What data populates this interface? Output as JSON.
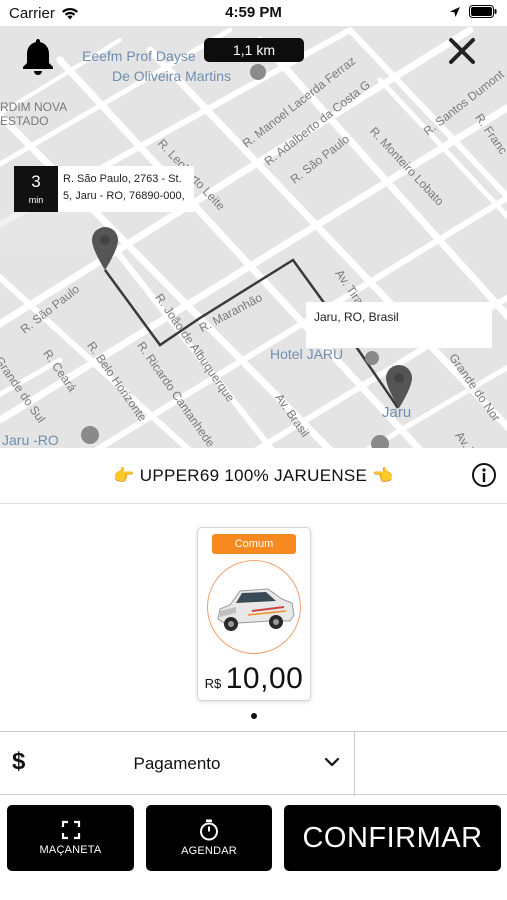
{
  "status_bar": {
    "carrier": "Carrier",
    "time": "4:59 PM",
    "icons": [
      "wifi-icon",
      "location-arrow-icon",
      "battery-icon"
    ]
  },
  "map": {
    "distance": "1,1 km",
    "labels": {
      "poi_school_1": "Eeefm Prof Dayse",
      "poi_school_2": "De Oliveira Martins",
      "jardim_1": "RDIM NOVA",
      "jardim_2": "ESTADO",
      "st_manoel": "R. Manoel Lacerda Ferraz",
      "st_adalberto": "R. Adalberto da Costa G",
      "st_santos": "R. Santos Dumont",
      "st_franc": "R. Franc",
      "st_leoberto": "R. Leoberto Leite",
      "st_saopaulo_top": "R. São Paulo",
      "st_monteiro": "R. Monteiro Lobato",
      "st_saopaulo_left": "R. São Paulo",
      "st_maranhao": "R. Maranhão",
      "st_joao": "R. João de Albuquerque",
      "st_tiradentes": "Av. Tirade",
      "st_grande_sul_left": "Grande do Sul",
      "st_ceara": "R. Ceará",
      "st_belo": "R. Belo Horizonte",
      "st_ricardo": "R. Ricardo Cantanhede",
      "st_brasil": "Av. Brasil",
      "st_grande_norte": "Grande do Nor",
      "st_av_right": "Av. Tu",
      "hotel": "Hotel JARU",
      "jaru_city": "Jaru",
      "jaru_ro": "Jaru -RO"
    },
    "origin": {
      "eta_value": "3",
      "eta_unit": "min",
      "address": "R. São Paulo, 2763 - St. 5, Jaru - RO, 76890-000,"
    },
    "destination": {
      "address": "Jaru, RO, Brasil"
    },
    "icons": [
      "bell-icon",
      "close-icon",
      "origin-pin-icon",
      "destination-pin-icon"
    ]
  },
  "header": {
    "title": "👉 UPPER69 100% JARUENSE 👈",
    "info_icon": "info-icon"
  },
  "vehicle": {
    "category": "Comum",
    "currency": "R$",
    "price": "10,00",
    "image": "car-icon"
  },
  "payment": {
    "currency_icon": "$",
    "label": "Pagamento",
    "chevron_icon": "chevron-down-icon"
  },
  "actions": {
    "macaneta": "MAÇANETA",
    "agendar": "AGENDAR",
    "confirmar": "CONFIRMAR"
  },
  "colors": {
    "accent": "#f7891f",
    "button_bg": "#000000",
    "map_bg": "#e4e4e4"
  }
}
